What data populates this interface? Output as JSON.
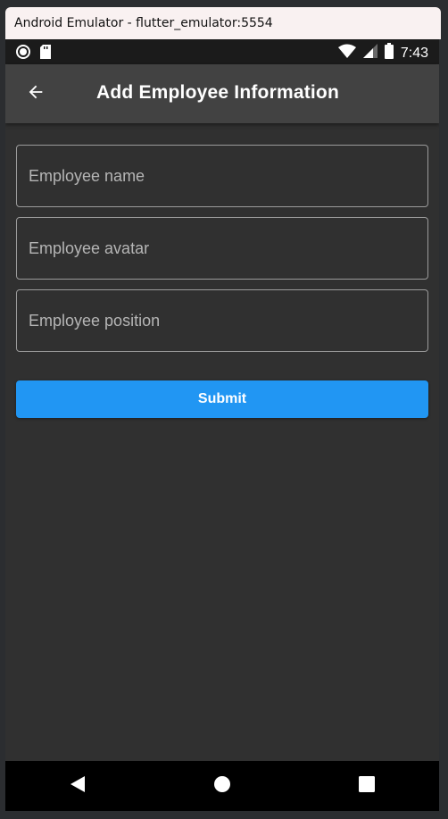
{
  "window": {
    "title": "Android Emulator - flutter_emulator:5554"
  },
  "status_bar": {
    "time": "7:43",
    "icons": [
      "record-icon",
      "sd-card-icon",
      "wifi-icon",
      "signal-icon",
      "battery-icon"
    ]
  },
  "app_bar": {
    "title": "Add Employee Information",
    "back_icon": "arrow-back-icon",
    "background": "#424242"
  },
  "form": {
    "name_placeholder": "Employee name",
    "avatar_placeholder": "Employee avatar",
    "position_placeholder": "Employee position",
    "name_value": "",
    "avatar_value": "",
    "position_value": ""
  },
  "submit": {
    "label": "Submit",
    "color": "#2196f3"
  },
  "nav_bar": {
    "icons": [
      "nav-back-icon",
      "nav-home-icon",
      "nav-recents-icon"
    ]
  },
  "colors": {
    "surface": "#303030",
    "border": "#9b9b9b",
    "text": "#ffffff"
  }
}
